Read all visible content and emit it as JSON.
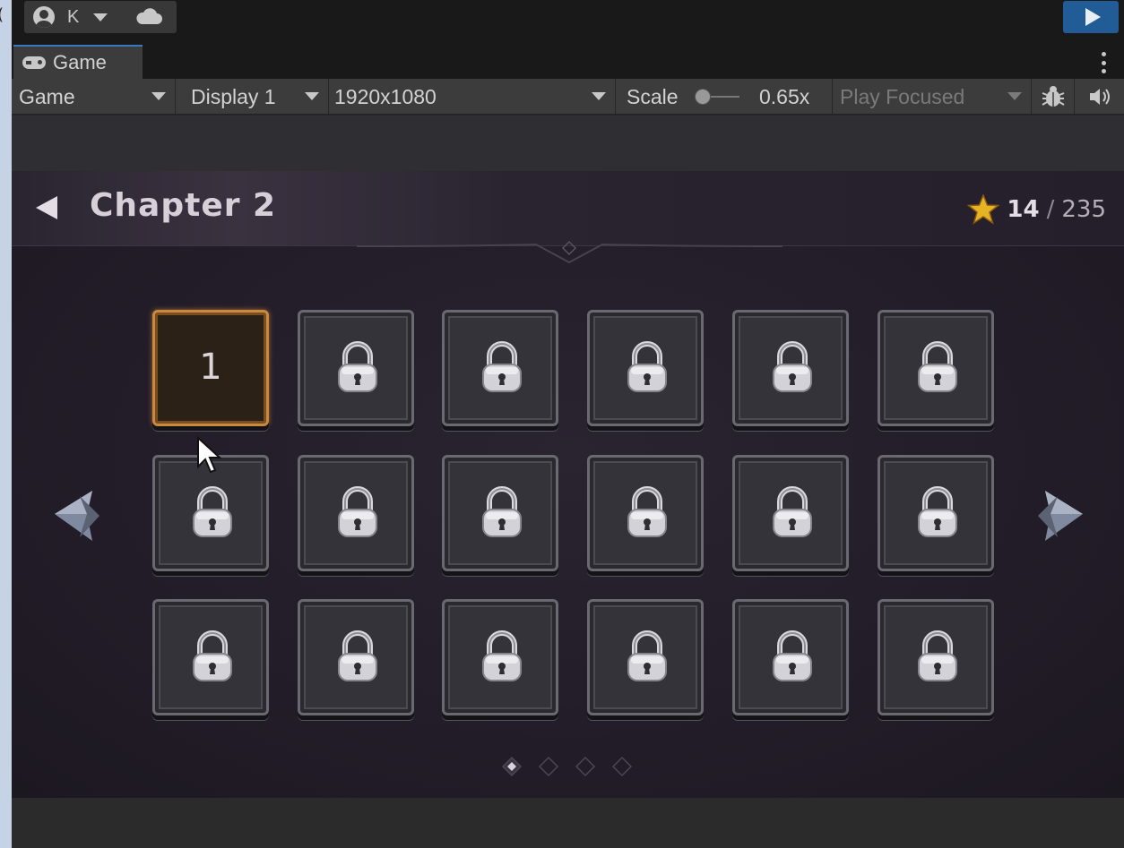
{
  "editor": {
    "left_glyph": "(",
    "account": {
      "initial": "K"
    },
    "tab": {
      "label": "Game"
    },
    "gamebar": {
      "view_mode": "Game",
      "display": "Display 1",
      "resolution": "1920x1080",
      "scale_label": "Scale",
      "scale_value": "0.65x",
      "play_mode": "Play Focused"
    }
  },
  "game": {
    "chapter_title": "Chapter 2",
    "stars": {
      "current": "14",
      "separator": "/",
      "total": "235"
    },
    "levels": [
      {
        "label": "1",
        "locked": false
      },
      {
        "label": "",
        "locked": true
      },
      {
        "label": "",
        "locked": true
      },
      {
        "label": "",
        "locked": true
      },
      {
        "label": "",
        "locked": true
      },
      {
        "label": "",
        "locked": true
      },
      {
        "label": "",
        "locked": true
      },
      {
        "label": "",
        "locked": true
      },
      {
        "label": "",
        "locked": true
      },
      {
        "label": "",
        "locked": true
      },
      {
        "label": "",
        "locked": true
      },
      {
        "label": "",
        "locked": true
      },
      {
        "label": "",
        "locked": true
      },
      {
        "label": "",
        "locked": true
      },
      {
        "label": "",
        "locked": true
      },
      {
        "label": "",
        "locked": true
      },
      {
        "label": "",
        "locked": true
      },
      {
        "label": "",
        "locked": true
      }
    ],
    "pages": {
      "count": 4,
      "current": 1
    }
  },
  "colors": {
    "play_button": "#225c96",
    "active_tile_border": "#c9893f",
    "star": "#e6b325"
  }
}
